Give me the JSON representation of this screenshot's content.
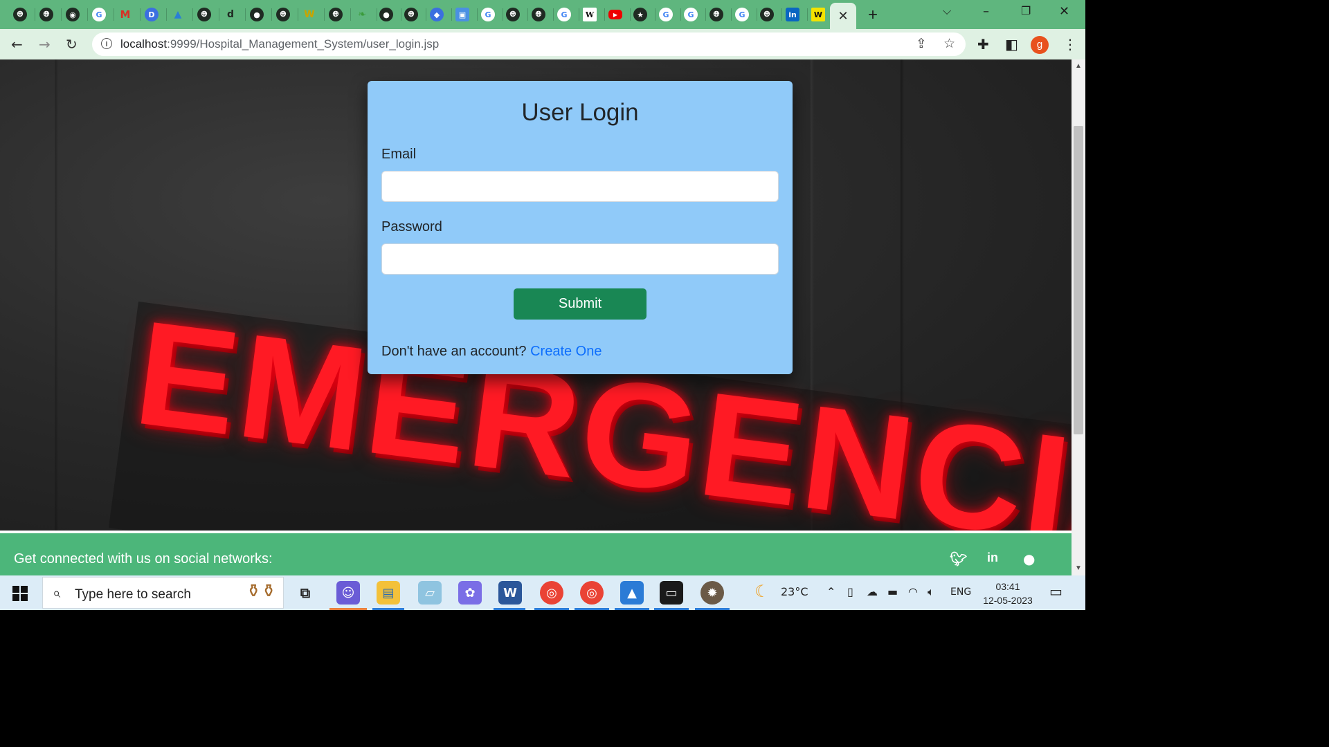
{
  "browser": {
    "active_tab_close": "✕",
    "new_tab": "+",
    "url_host": "localhost",
    "url_path": ":9999/Hospital_Management_System/user_login.jsp",
    "profile_initial": "g",
    "tab_favicons": [
      "globe",
      "globe",
      "globe",
      "G",
      "M",
      "D",
      "A",
      "globe",
      "d",
      "github",
      "globe",
      "W",
      "globe",
      "leaf",
      "github",
      "globe",
      "diamond",
      "box",
      "G",
      "globe",
      "globe",
      "G",
      "W",
      "youtube",
      "star",
      "G",
      "G",
      "globe",
      "G",
      "globe",
      "in",
      "W"
    ]
  },
  "hero": {
    "sign_text": "EMERGENCIA"
  },
  "login": {
    "title": "User Login",
    "email_label": "Email",
    "email_value": "",
    "password_label": "Password",
    "password_value": "",
    "submit_label": "Submit",
    "signup_prompt": "Don't have an account?",
    "signup_link": "Create One"
  },
  "footer": {
    "text": "Get connected with us on social networks:",
    "social": [
      "twitter-icon",
      "linkedin-icon",
      "github-icon"
    ]
  },
  "taskbar": {
    "search_placeholder": "Type here to search",
    "weather": "23°C",
    "language": "ENG",
    "time": "03:41",
    "date": "12-05-2023"
  },
  "colors": {
    "tab_strip": "#5fb67e",
    "toolbar": "#dff1e3",
    "card": "#90caf9",
    "submit": "#198754",
    "link": "#0d6efd",
    "footer": "#4cb67a",
    "sign": "#ff1a24"
  }
}
